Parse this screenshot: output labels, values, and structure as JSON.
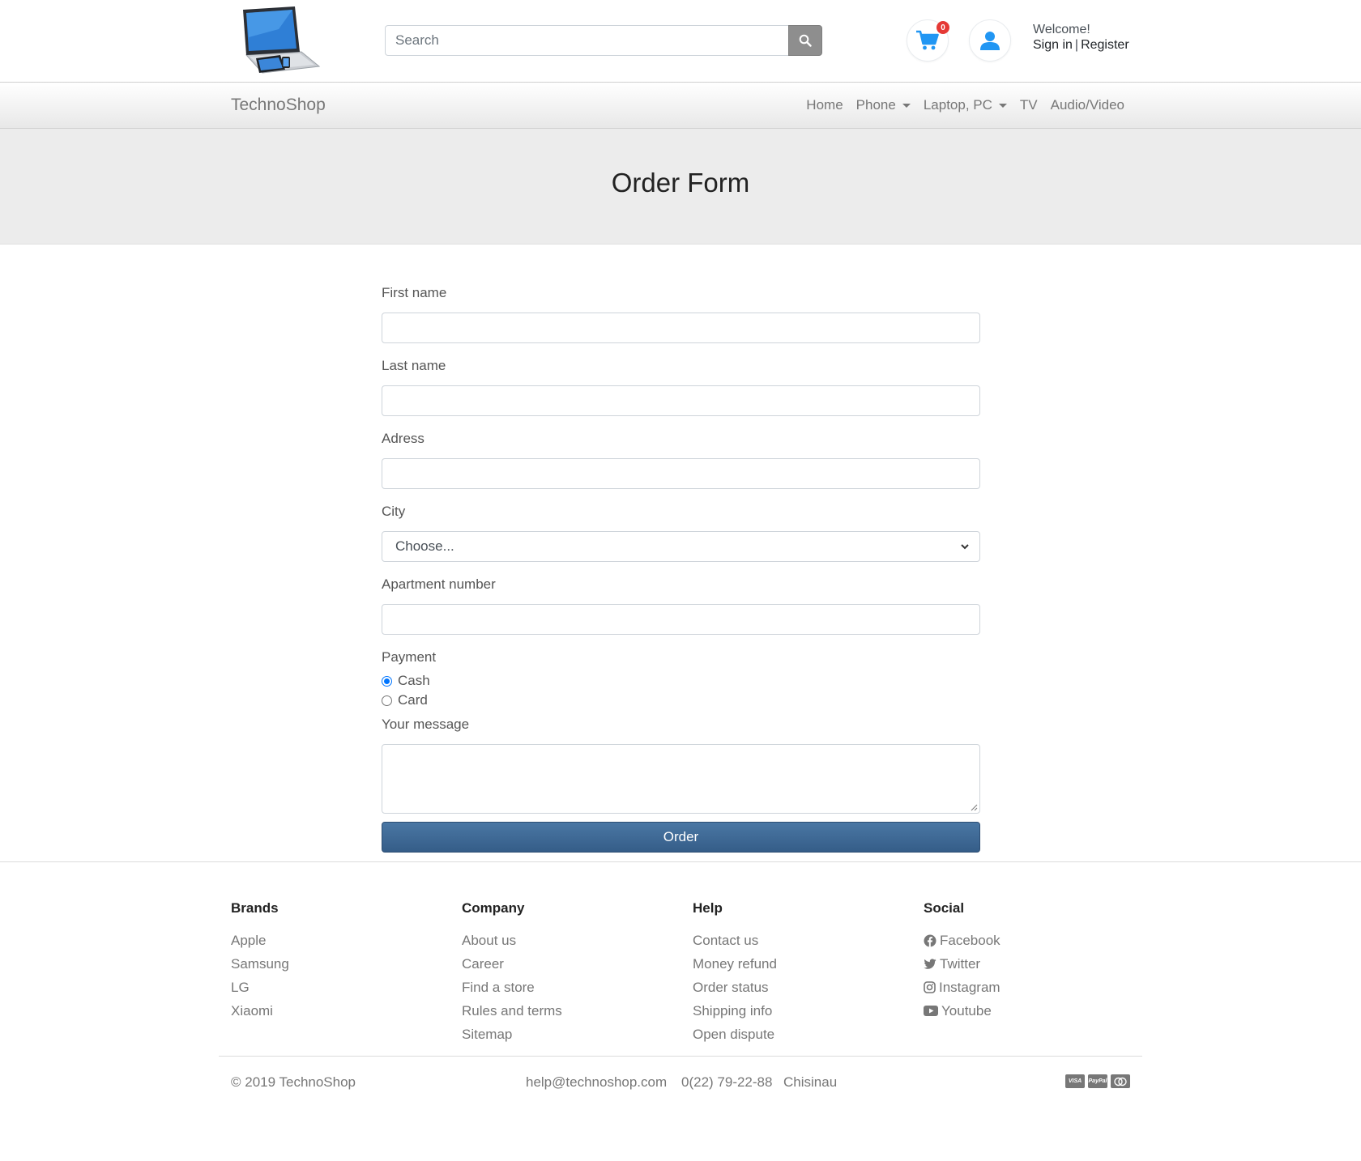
{
  "header": {
    "search_placeholder": "Search",
    "cart_count": "0",
    "welcome": "Welcome!",
    "sign_in": "Sign in",
    "separator": "|",
    "register": "Register"
  },
  "navbar": {
    "brand": "TechnoShop",
    "links": [
      {
        "label": "Home",
        "dropdown": false
      },
      {
        "label": "Phone",
        "dropdown": true
      },
      {
        "label": "Laptop, PC",
        "dropdown": true
      },
      {
        "label": "TV",
        "dropdown": false
      },
      {
        "label": "Audio/Video",
        "dropdown": false
      }
    ]
  },
  "page": {
    "title": "Order Form"
  },
  "form": {
    "first_name_label": "First name",
    "last_name_label": "Last name",
    "address_label": "Adress",
    "city_label": "City",
    "city_selected": "Choose...",
    "apartment_label": "Apartment number",
    "payment_label": "Payment",
    "payment_options": [
      {
        "label": "Cash",
        "checked": true
      },
      {
        "label": "Card",
        "checked": false
      }
    ],
    "message_label": "Your message",
    "submit_label": "Order"
  },
  "footer": {
    "columns": [
      {
        "title": "Brands",
        "links": [
          "Apple",
          "Samsung",
          "LG",
          "Xiaomi"
        ]
      },
      {
        "title": "Company",
        "links": [
          "About us",
          "Career",
          "Find a store",
          "Rules and terms",
          "Sitemap"
        ]
      },
      {
        "title": "Help",
        "links": [
          "Contact us",
          "Money refund",
          "Order status",
          "Shipping info",
          "Open dispute"
        ]
      },
      {
        "title": "Social",
        "links": [
          "Facebook",
          "Twitter",
          "Instagram",
          "Youtube"
        ]
      }
    ],
    "copyright": "© 2019 TechnoShop",
    "email": "help@technoshop.com",
    "phone": "0(22) 79-22-88",
    "city": "Chisinau"
  },
  "colors": {
    "accent_blue": "#2196f3",
    "order_button": "#3f6893",
    "badge_red": "#e53935"
  },
  "icons": {
    "search": "search-icon",
    "cart": "cart-icon",
    "user": "user-icon",
    "facebook": "facebook-icon",
    "twitter": "twitter-icon",
    "instagram": "instagram-icon",
    "youtube": "youtube-icon",
    "payments": [
      "visa-icon",
      "paypal-icon",
      "mastercard-icon"
    ]
  }
}
